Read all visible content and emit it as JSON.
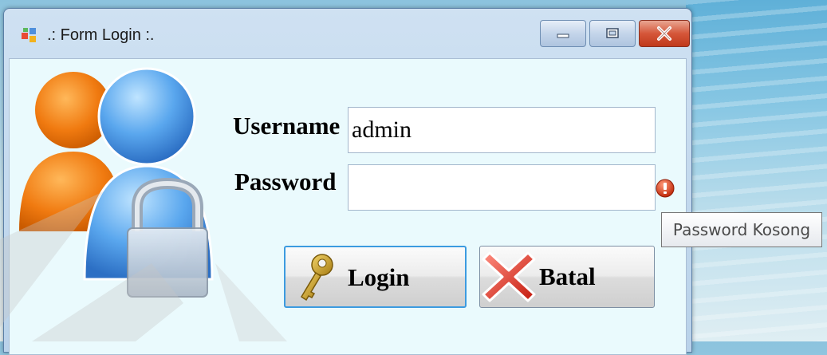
{
  "window": {
    "title": ".: Form Login :.",
    "controls": {
      "minimize": "minimize-icon",
      "maximize": "maximize-icon",
      "close": "close-icon"
    }
  },
  "form": {
    "username_label": "Username",
    "username_value": "admin",
    "password_label": "Password",
    "password_value": "",
    "error_icon": "error-icon"
  },
  "buttons": {
    "login_label": "Login",
    "cancel_label": "Batal"
  },
  "tooltip": {
    "text": "Password Kosong"
  },
  "colors": {
    "accent": "#3c9be0",
    "error": "#e03b1a",
    "avatar_front": "#4a90e2",
    "avatar_back": "#f07a10"
  }
}
